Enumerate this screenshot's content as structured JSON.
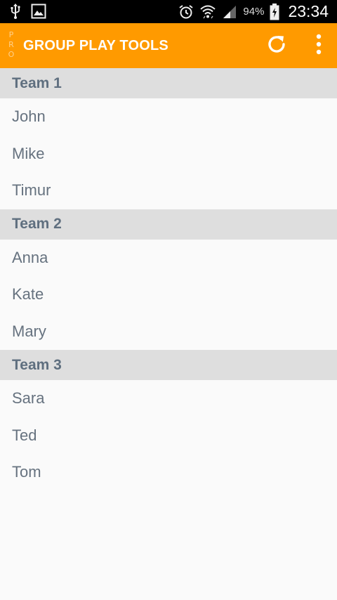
{
  "status_bar": {
    "battery_percent": "94%",
    "time": "23:34",
    "icons": [
      "usb-icon",
      "gallery-icon",
      "alarm-icon",
      "wifi-icon",
      "signal-icon",
      "battery-charging-icon"
    ]
  },
  "action_bar": {
    "badge": [
      "P",
      "R",
      "O"
    ],
    "title": "GROUP PLAY TOOLS",
    "icons": [
      "refresh-icon",
      "overflow-menu-icon"
    ],
    "accent_color": "#ff9a00"
  },
  "teams": [
    {
      "name": "Team 1",
      "members": [
        "John",
        "Mike",
        "Timur"
      ]
    },
    {
      "name": "Team 2",
      "members": [
        "Anna",
        "Kate",
        "Mary"
      ]
    },
    {
      "name": "Team 3",
      "members": [
        "Sara",
        "Ted",
        "Tom"
      ]
    }
  ]
}
